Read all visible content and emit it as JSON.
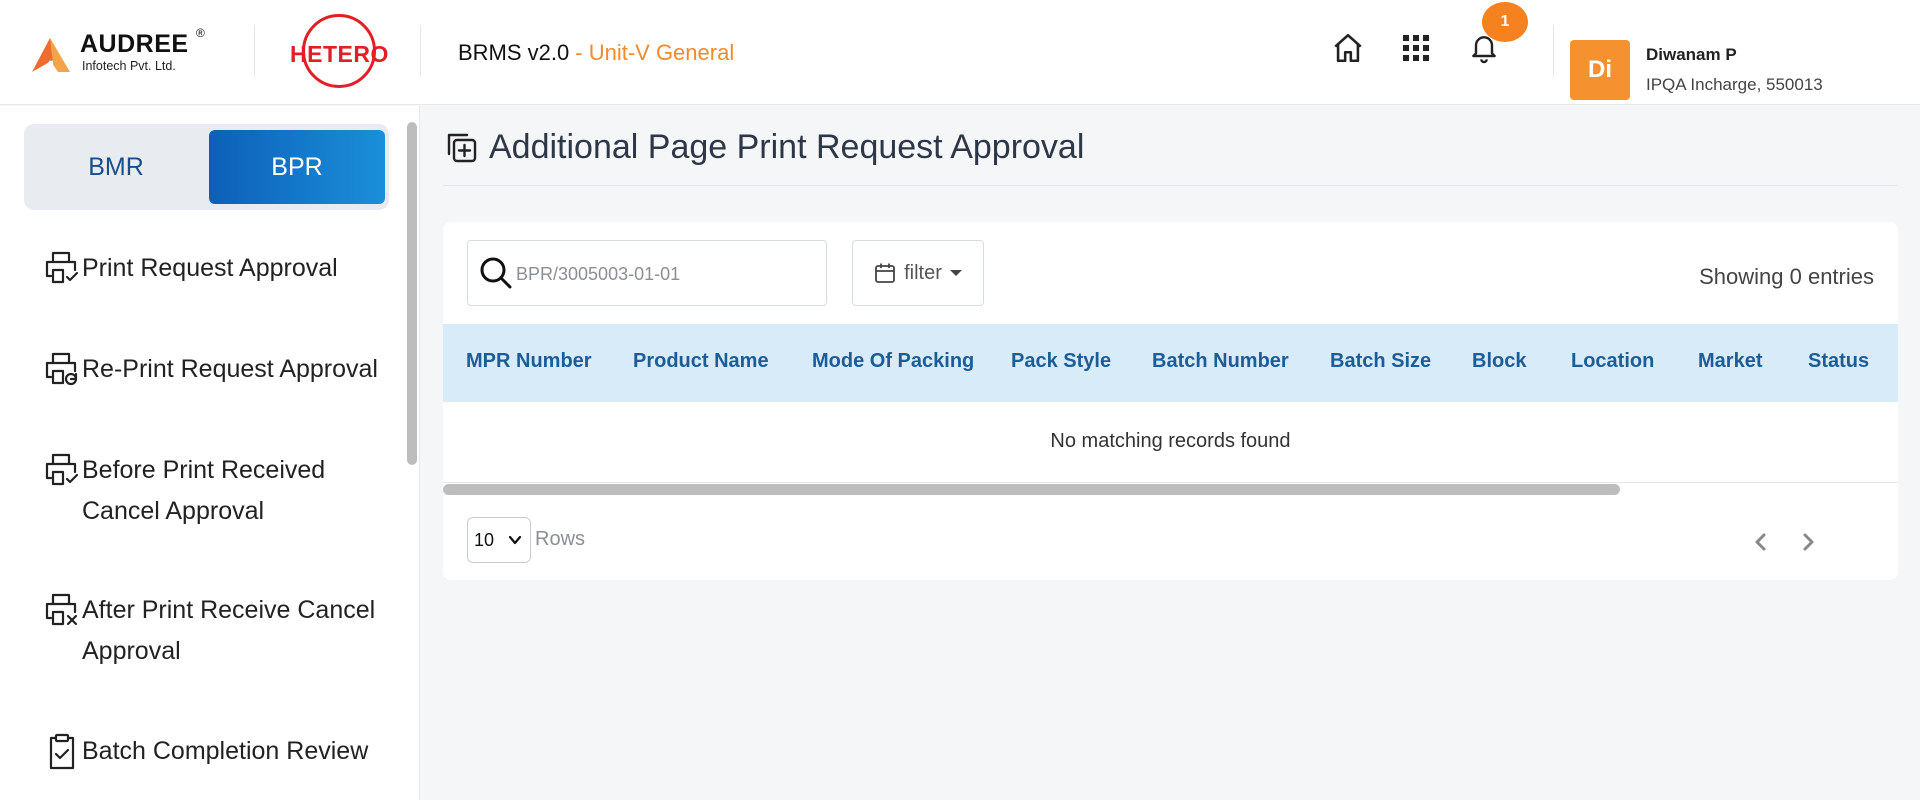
{
  "header": {
    "audree_name": "AUDREE",
    "audree_reg": "®",
    "audree_sub": "Infotech Pvt. Ltd.",
    "hetero_name": "HETERO",
    "app_version": "BRMS v2.0",
    "unit": "- Unit-V General",
    "notification_count": "1",
    "user_initials": "Di",
    "user_name": "Diwanam P",
    "user_role": "IPQA Incharge, 550013",
    "icons": [
      "home-icon",
      "apps-grid-icon",
      "bell-icon"
    ],
    "accent_color": "#f5821f",
    "unit_color": "#f28a2e",
    "hetero_color": "#e31e24"
  },
  "sidebar": {
    "tabs": [
      {
        "label": "BMR",
        "active": false
      },
      {
        "label": "BPR",
        "active": true
      }
    ],
    "items": [
      {
        "label": "Print Request Approval",
        "icon": "printer-check-icon"
      },
      {
        "label": "Re-Print Request Approval",
        "icon": "printer-refresh-icon"
      },
      {
        "label": "Before Print Received Cancel Approval",
        "icon": "printer-check-icon"
      },
      {
        "label": "After Print Receive Cancel Approval",
        "icon": "printer-cancel-icon"
      },
      {
        "label": "Batch Completion Review",
        "icon": "clipboard-check-icon"
      }
    ],
    "active_tab_color": "#0d5fb8"
  },
  "main": {
    "title": "Additional Page Print Request Approval",
    "title_icon": "copy-plus-icon",
    "search": {
      "placeholder": "BPR/3005003-01-01",
      "value": ""
    },
    "filter_label": "filter",
    "showing": "Showing 0 entries",
    "table": {
      "columns": [
        "MPR Number",
        "Product Name",
        "Mode Of Packing",
        "Pack Style",
        "Batch Number",
        "Batch Size",
        "Block",
        "Location",
        "Market",
        "Status"
      ],
      "rows": [],
      "empty_text": "No matching records found",
      "header_bg": "#d8ebf8",
      "header_color": "#1b5c99"
    },
    "pagination": {
      "rows_value": "10",
      "rows_label": "Rows"
    }
  }
}
